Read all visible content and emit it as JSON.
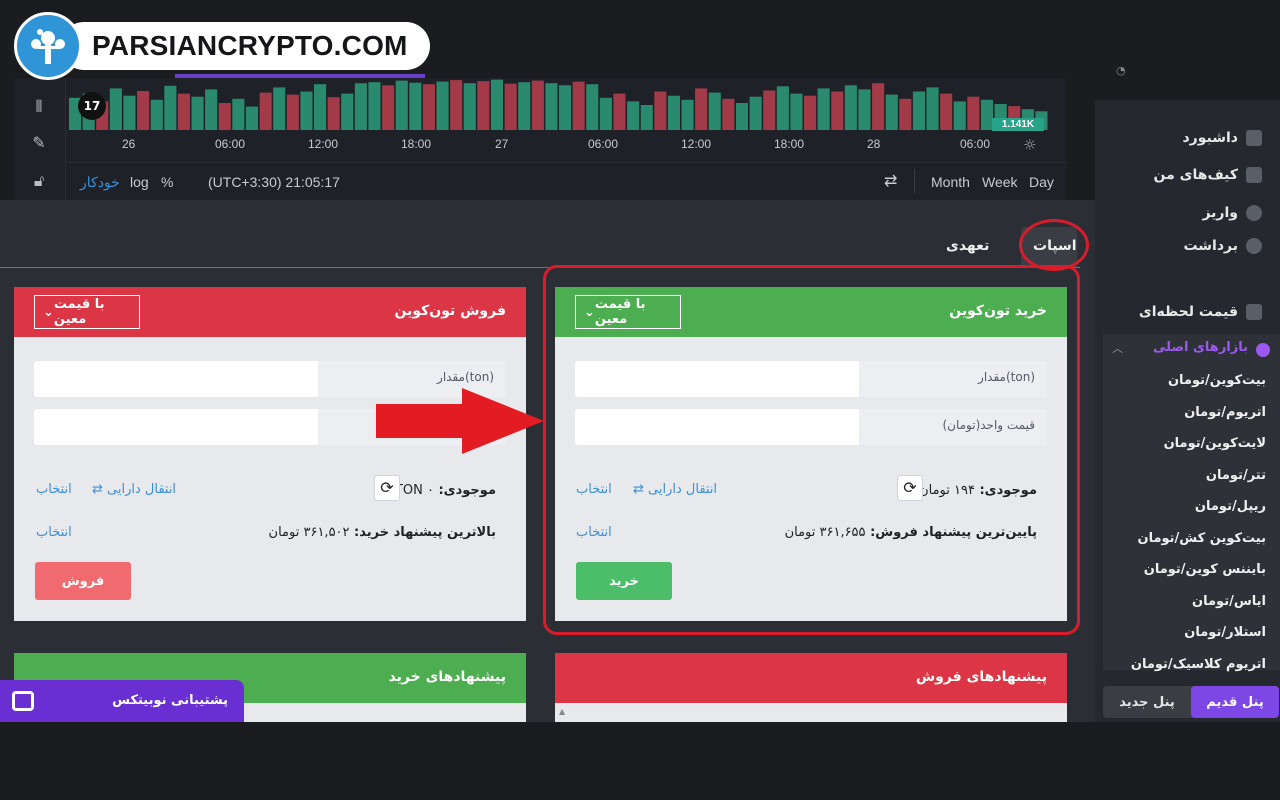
{
  "brand": {
    "watermark": "PARSIANCRYPTO.COM"
  },
  "chart": {
    "tv_logo": "17",
    "price_tag": "1.141K",
    "x_ticks": [
      "26",
      "06:00",
      "12:00",
      "18:00",
      "27",
      "06:00",
      "12:00",
      "18:00",
      "28",
      "06:00"
    ],
    "footer": {
      "auto": "خودکار",
      "log": "log",
      "percent": "%",
      "time": "(UTC+3:30) 21:05:17",
      "month": "Month",
      "week": "Week",
      "day": "Day"
    },
    "volume_bars": [
      {
        "h": 0.62,
        "c": "g"
      },
      {
        "h": 0.7,
        "c": "g"
      },
      {
        "h": 0.55,
        "c": "r"
      },
      {
        "h": 0.8,
        "c": "g"
      },
      {
        "h": 0.66,
        "c": "g"
      },
      {
        "h": 0.75,
        "c": "r"
      },
      {
        "h": 0.58,
        "c": "g"
      },
      {
        "h": 0.85,
        "c": "g"
      },
      {
        "h": 0.7,
        "c": "r"
      },
      {
        "h": 0.64,
        "c": "g"
      },
      {
        "h": 0.78,
        "c": "g"
      },
      {
        "h": 0.52,
        "c": "r"
      },
      {
        "h": 0.6,
        "c": "g"
      },
      {
        "h": 0.45,
        "c": "g"
      },
      {
        "h": 0.72,
        "c": "r"
      },
      {
        "h": 0.82,
        "c": "g"
      },
      {
        "h": 0.68,
        "c": "r"
      },
      {
        "h": 0.74,
        "c": "g"
      },
      {
        "h": 0.88,
        "c": "g"
      },
      {
        "h": 0.63,
        "c": "r"
      },
      {
        "h": 0.7,
        "c": "g"
      },
      {
        "h": 0.9,
        "c": "g"
      },
      {
        "h": 0.92,
        "c": "g"
      },
      {
        "h": 0.86,
        "c": "r"
      },
      {
        "h": 0.95,
        "c": "g"
      },
      {
        "h": 0.91,
        "c": "g"
      },
      {
        "h": 0.88,
        "c": "r"
      },
      {
        "h": 0.93,
        "c": "g"
      },
      {
        "h": 0.96,
        "c": "r"
      },
      {
        "h": 0.9,
        "c": "g"
      },
      {
        "h": 0.94,
        "c": "r"
      },
      {
        "h": 0.97,
        "c": "g"
      },
      {
        "h": 0.89,
        "c": "r"
      },
      {
        "h": 0.92,
        "c": "g"
      },
      {
        "h": 0.95,
        "c": "r"
      },
      {
        "h": 0.9,
        "c": "g"
      },
      {
        "h": 0.86,
        "c": "g"
      },
      {
        "h": 0.93,
        "c": "r"
      },
      {
        "h": 0.88,
        "c": "g"
      },
      {
        "h": 0.62,
        "c": "g"
      },
      {
        "h": 0.7,
        "c": "r"
      },
      {
        "h": 0.55,
        "c": "g"
      },
      {
        "h": 0.48,
        "c": "g"
      },
      {
        "h": 0.74,
        "c": "r"
      },
      {
        "h": 0.66,
        "c": "g"
      },
      {
        "h": 0.58,
        "c": "g"
      },
      {
        "h": 0.8,
        "c": "r"
      },
      {
        "h": 0.72,
        "c": "g"
      },
      {
        "h": 0.6,
        "c": "r"
      },
      {
        "h": 0.52,
        "c": "g"
      },
      {
        "h": 0.64,
        "c": "g"
      },
      {
        "h": 0.76,
        "c": "r"
      },
      {
        "h": 0.84,
        "c": "g"
      },
      {
        "h": 0.7,
        "c": "g"
      },
      {
        "h": 0.66,
        "c": "r"
      },
      {
        "h": 0.8,
        "c": "g"
      },
      {
        "h": 0.74,
        "c": "r"
      },
      {
        "h": 0.86,
        "c": "g"
      },
      {
        "h": 0.78,
        "c": "g"
      },
      {
        "h": 0.9,
        "c": "r"
      },
      {
        "h": 0.68,
        "c": "g"
      },
      {
        "h": 0.6,
        "c": "r"
      },
      {
        "h": 0.74,
        "c": "g"
      },
      {
        "h": 0.82,
        "c": "g"
      },
      {
        "h": 0.7,
        "c": "r"
      },
      {
        "h": 0.55,
        "c": "g"
      },
      {
        "h": 0.64,
        "c": "r"
      },
      {
        "h": 0.58,
        "c": "g"
      },
      {
        "h": 0.5,
        "c": "g"
      },
      {
        "h": 0.46,
        "c": "r"
      },
      {
        "h": 0.4,
        "c": "g"
      },
      {
        "h": 0.36,
        "c": "g"
      }
    ]
  },
  "tabs": {
    "spot": "اسپات",
    "margin": "تعهدی"
  },
  "buy_card": {
    "title": "خرید تون‌کوین",
    "order_type": "با قیمت معین",
    "amount_label": "مقدار(ton)",
    "price_label": "قیمت واحد(تومان)",
    "balance_label": "موجودی:",
    "balance_value": "۱۹۴ تومان",
    "transfer": "انتقال دارایی",
    "select": "انتخاب",
    "best_label": "پایین‌ترین پیشنهاد فروش:",
    "best_value": "۳۶۱,۶۵۵ تومان",
    "select2": "انتخاب",
    "button": "خرید"
  },
  "sell_card": {
    "title": "فروش تون‌کوین",
    "order_type": "با قیمت معین",
    "amount_label": "مقدار(ton)",
    "balance_label": "موجودی:",
    "balance_value": "TON ۰",
    "transfer": "انتقال دارایی",
    "select": "انتخاب",
    "best_label": "بالاترین پیشنهاد خرید:",
    "best_value": "۳۶۱,۵۰۲ تومان",
    "select2": "انتخاب",
    "button": "فروش"
  },
  "offers": {
    "sell_title": "پیشنهادهای فروش",
    "buy_title": "پیشنهادهای خرید"
  },
  "support": {
    "label": "پشتیبانی نوبیتکس"
  },
  "sidebar": {
    "items": [
      "داشبورد",
      "کیف‌های من",
      "واریز",
      "برداشت"
    ],
    "live_price": "قیمت لحظه‌ای",
    "markets_head": "بازارهای اصلی",
    "markets": [
      "بیت‌کوین/تومان",
      "اتریوم/تومان",
      "لایت‌کوین/تومان",
      "تتر/تومان",
      "ریپل/تومان",
      "بیت‌کوین کش/تومان",
      "بایننس کوین/تومان",
      "ایاس/تومان",
      "استلار/تومان",
      "اتریوم کلاسیک/تومان"
    ],
    "panel_old": "پنل قدیم",
    "panel_new": "پنل جدید"
  },
  "colors": {
    "buy": "#4cae50",
    "sell": "#dc3545",
    "accent": "#7d47e6",
    "highlight": "#d91c2b"
  }
}
